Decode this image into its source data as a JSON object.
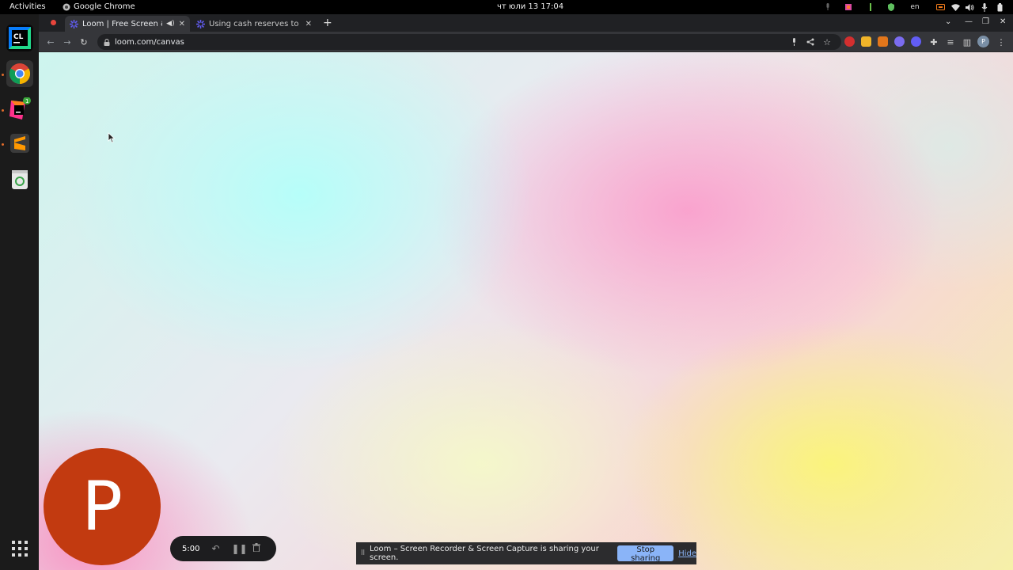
{
  "topbar": {
    "activities": "Activities",
    "app_name": "Google Chrome",
    "clock": "чт юли 13  17:04",
    "lang": "en"
  },
  "chrome": {
    "tabs": [
      {
        "title": "Loom | Free Screen & V",
        "active": true
      },
      {
        "title": "Using cash reserves to bu",
        "active": false
      }
    ],
    "new_tab": "+",
    "url": "loom.com/canvas",
    "profile_initial": "P"
  },
  "loom": {
    "avatar_initial": "P",
    "timer": "5:00"
  },
  "sharebar": {
    "message": "Loom – Screen Recorder & Screen Capture is sharing your screen.",
    "stop_label": "Stop sharing",
    "hide_label": "Hide"
  },
  "dock": {
    "badge_count": "1"
  },
  "colors": {
    "camera_bubble": "#c23a10",
    "stop_button": "#8ab4f8",
    "chrome_toolbar": "#35363a",
    "chrome_tabstrip": "#202124"
  }
}
